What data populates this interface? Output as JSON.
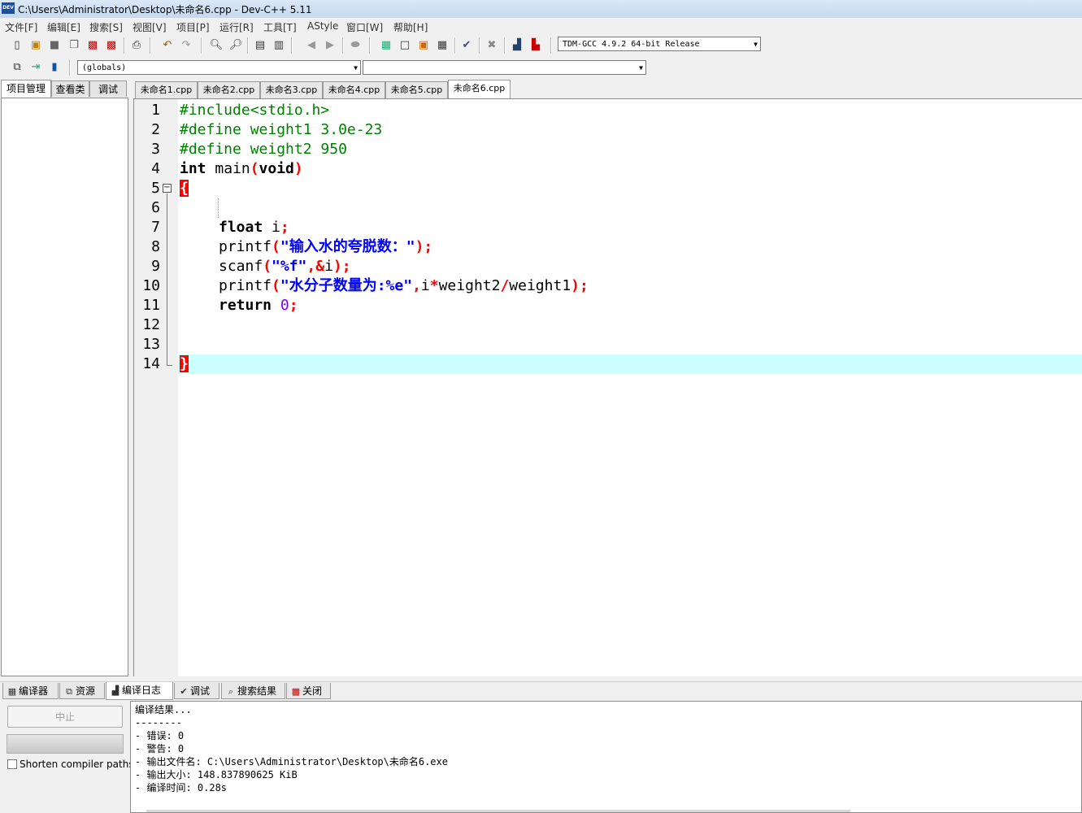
{
  "window": {
    "title": "C:\\Users\\Administrator\\Desktop\\未命名6.cpp - Dev-C++ 5.11",
    "icon_text": "DEV"
  },
  "menu": [
    "文件[F]",
    "编辑[E]",
    "搜索[S]",
    "视图[V]",
    "项目[P]",
    "运行[R]",
    "工具[T]",
    "AStyle",
    "窗口[W]",
    "帮助[H]"
  ],
  "toolbar": {
    "compiler_select": "TDM-GCC 4.9.2 64-bit Release",
    "scope_select": "(globals)",
    "symbol_select": ""
  },
  "left_tabs": [
    "项目管理",
    "查看类",
    "调试"
  ],
  "file_tabs": [
    "未命名1.cpp",
    "未命名2.cpp",
    "未命名3.cpp",
    "未命名4.cpp",
    "未命名5.cpp",
    "未命名6.cpp"
  ],
  "active_file_tab": 5,
  "editor": {
    "line_numbers": [
      "1",
      "2",
      "3",
      "4",
      "5",
      "6",
      "7",
      "8",
      "9",
      "10",
      "11",
      "12",
      "13",
      "14"
    ],
    "lines": {
      "l1": "#include<stdio.h>",
      "l2": "#define weight1 3.0e-23",
      "l3": "#define weight2 950",
      "l4a": "int",
      "l4b": " main",
      "l4c": "(",
      "l4d": "void",
      "l4e": ")",
      "l5": "{",
      "l7a": "float",
      "l7b": " i",
      "l7c": ";",
      "l8a": "printf",
      "l8b": "(",
      "l8c": "\"输入水的夸脱数：\"",
      "l8d": ");",
      "l9a": "scanf",
      "l9b": "(",
      "l9c": "\"%f\"",
      "l9d": ",&",
      "l9e": "i",
      "l9f": ");",
      "l10a": "printf",
      "l10b": "(",
      "l10c": "\"水分子数量为:%e\"",
      "l10d": ",",
      "l10e": "i",
      "l10f": "*",
      "l10g": "weight2",
      "l10h": "/",
      "l10i": "weight1",
      "l10j": ");",
      "l11a": "return",
      "l11b": " 0",
      "l11c": ";",
      "l14": "}"
    }
  },
  "bottom_tabs": [
    "编译器",
    "资源",
    "编译日志",
    "调试",
    "搜索结果",
    "关闭"
  ],
  "active_bottom_tab": 2,
  "compile_panel": {
    "abort_label": "中止",
    "shorten_label": "Shorten compiler paths",
    "log": [
      "编译结果...",
      "--------",
      "- 错误: 0",
      "- 警告: 0",
      "- 输出文件名: C:\\Users\\Administrator\\Desktop\\未命名6.exe",
      "- 输出大小: 148.837890625 KiB",
      "- 编译时间: 0.28s"
    ]
  },
  "colors": {
    "preprocessor": "#008000",
    "string": "#0000ff",
    "symbol": "#ff0000",
    "number": "#8000ff",
    "active_line": "#ccffff"
  }
}
